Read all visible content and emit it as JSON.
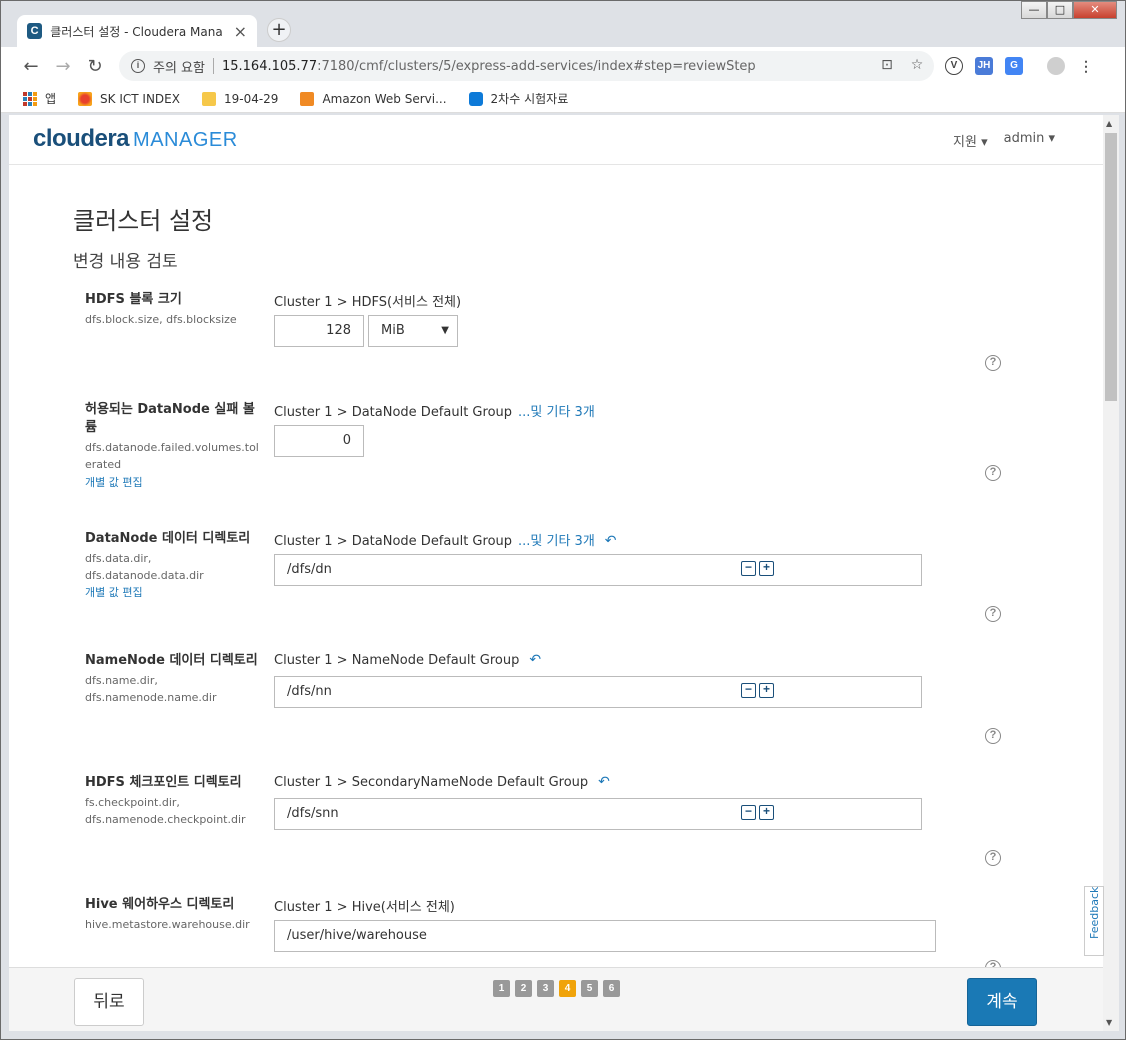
{
  "browser": {
    "tab_title": "클러스터 설정 - Cloudera Mana",
    "tab_favicon": "C",
    "tab_close": "×",
    "new_tab": "+",
    "security_label": "주의 요함",
    "url_host": "15.164.105.77",
    "url_rest": ":7180/cmf/clusters/5/express-add-services/index#step=reviewStep",
    "ext_v": "V",
    "ext_jh": "JH",
    "ext_tr": "G"
  },
  "bookmarks": [
    {
      "label": "앱",
      "icon": "apps-icon"
    },
    {
      "label": "SK ICT INDEX",
      "icon": "sk-icon"
    },
    {
      "label": "19-04-29",
      "icon": "folder-icon"
    },
    {
      "label": "Amazon Web Servi...",
      "icon": "aws-icon"
    },
    {
      "label": "2차수 시험자료",
      "icon": "nextcloud-icon"
    }
  ],
  "header": {
    "logo_cloudera": "cloudera",
    "logo_manager": "MANAGER",
    "support_label": "지원 ▾",
    "user_label": "admin ▾"
  },
  "page": {
    "title": "클러스터 설정",
    "subtitle": "변경 내용 검토"
  },
  "properties": [
    {
      "label": "HDFS 블록 크기",
      "key": "dfs.block.size, dfs.blocksize",
      "scope": "Cluster 1 > HDFS(서비스 전체)",
      "value": "128",
      "unit": "MiB"
    },
    {
      "label": "허용되는 DataNode 실패 볼륨",
      "key": "dfs.datanode.failed.volumes.tolerated",
      "scope": "Cluster 1 > DataNode Default Group",
      "more": "...및 기타 3개",
      "value": "0",
      "edit_link": "개별 값 편집"
    },
    {
      "label": "DataNode 데이터 디렉토리",
      "key": "dfs.data.dir,\ndfs.datanode.data.dir",
      "scope": "Cluster 1 > DataNode Default Group",
      "more": "...및 기타 3개",
      "value": "/dfs/dn",
      "edit_link": "개별 값 편집"
    },
    {
      "label": "NameNode 데이터 디렉토리",
      "key": "dfs.name.dir,\ndfs.namenode.name.dir",
      "scope": "Cluster 1 > NameNode Default Group",
      "value": "/dfs/nn"
    },
    {
      "label": "HDFS 체크포인트 디렉토리",
      "key": "fs.checkpoint.dir,\ndfs.namenode.checkpoint.dir",
      "scope": "Cluster 1 > SecondaryNameNode Default Group",
      "value": "/dfs/snn"
    },
    {
      "label": "Hive 웨어하우스 디렉토리",
      "key": "hive.metastore.warehouse.dir",
      "scope": "Cluster 1 > Hive(서비스 전체)",
      "value": "/user/hive/warehouse"
    }
  ],
  "feedback_label": "Feedback",
  "footer": {
    "back_label": "뒤로",
    "continue_label": "계속",
    "steps": [
      "1",
      "2",
      "3",
      "4",
      "5",
      "6"
    ],
    "active_step": "4"
  }
}
